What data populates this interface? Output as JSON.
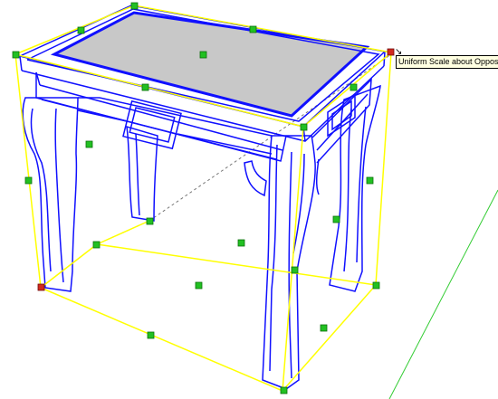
{
  "tool": {
    "name": "Uniform Scale about Opposite Point",
    "tooltip": "Uniform Scale about Opposite Point",
    "cursor_icon": "scale-cursor-icon"
  },
  "colors": {
    "background": "#ffffff",
    "bounding_box": "#ffff00",
    "selection_edges": "#1010ff",
    "grip_handle": "#22c022",
    "active_grip": "#d22a1e",
    "top_surface": "#c8c8c8",
    "inferred_axis": "#33cc33"
  }
}
